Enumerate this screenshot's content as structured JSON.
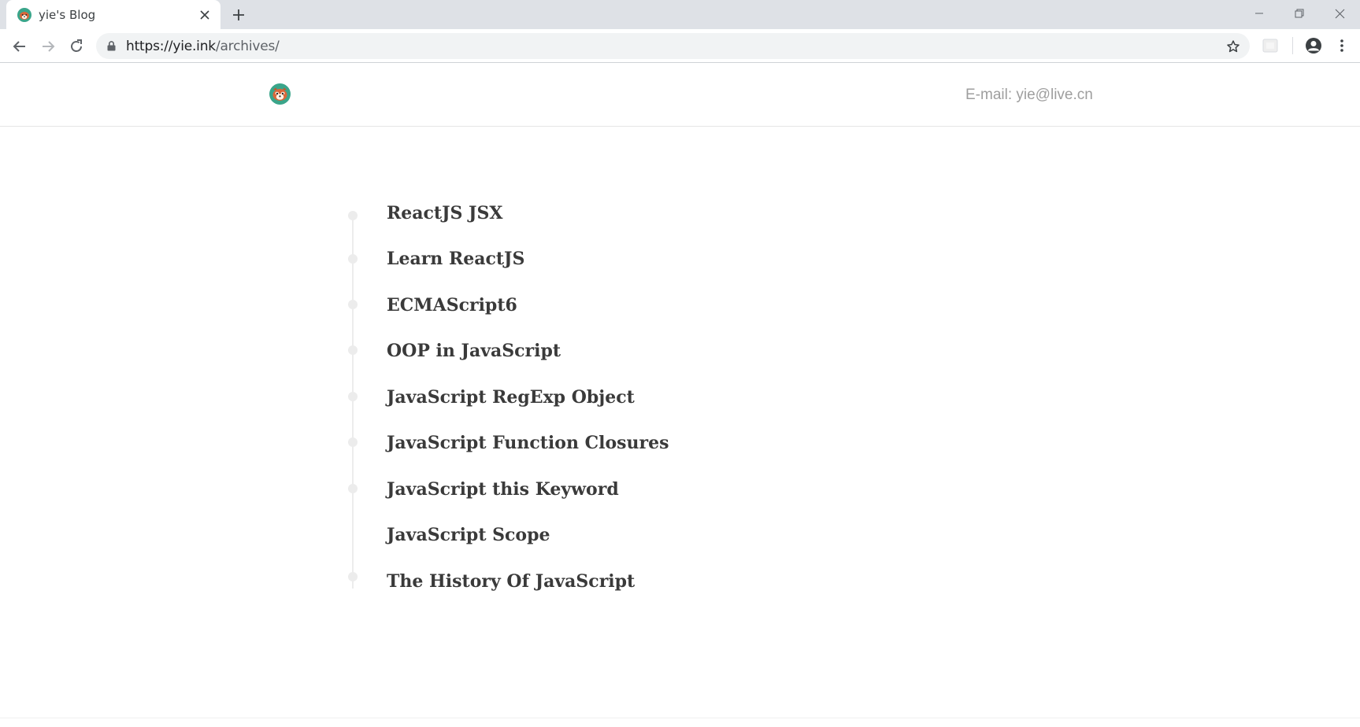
{
  "browser": {
    "tab": {
      "title": "yie's Blog",
      "favicon": "red-panda-icon"
    },
    "url": {
      "host": "https://yie.ink",
      "path": "/archives/"
    },
    "colors": {
      "tabstrip": "#dee1e6",
      "omnibox": "#f1f3f4"
    }
  },
  "site": {
    "logo": "red-panda-avatar",
    "email": "E-mail: yie@live.cn"
  },
  "archives": [
    {
      "title": "ReactJS JSX"
    },
    {
      "title": "Learn ReactJS"
    },
    {
      "title": "ECMAScript6"
    },
    {
      "title": "OOP in JavaScript"
    },
    {
      "title": "JavaScript RegExp Object"
    },
    {
      "title": "JavaScript Function Closures"
    },
    {
      "title": "JavaScript this Keyword"
    },
    {
      "title": "JavaScript Scope"
    },
    {
      "title": "The History Of JavaScript"
    }
  ],
  "colors": {
    "title": "#3a3a3a",
    "timeline": "#ececec",
    "email": "#9e9e9e",
    "logo_bg": "#3aa58a"
  }
}
